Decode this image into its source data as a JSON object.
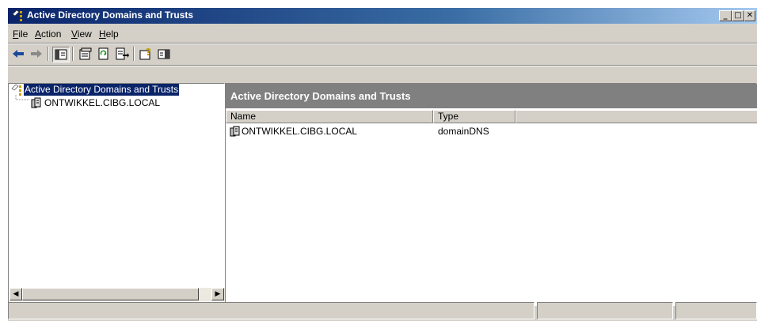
{
  "window": {
    "title": "Active Directory Domains and Trusts",
    "minimize": "_",
    "maximize": "□",
    "close": "✕"
  },
  "menu": {
    "items": [
      {
        "label": "File",
        "accel": "F",
        "rest": "ile"
      },
      {
        "label": "Action",
        "accel": "A",
        "rest": "ction"
      },
      {
        "label": "View",
        "accel": "V",
        "rest": "iew"
      },
      {
        "label": "Help",
        "accel": "H",
        "rest": "elp"
      }
    ]
  },
  "toolbar": {
    "back": "back-arrow-icon",
    "forward": "forward-arrow-icon",
    "show_hide_tree": "show-hide-console-tree-icon",
    "properties": "properties-icon",
    "refresh": "refresh-icon",
    "export_list": "export-list-icon",
    "help": "help-icon",
    "action_pane": "action-pane-icon"
  },
  "tree": {
    "root_label": "Active Directory Domains and Trusts",
    "child_label": "ONTWIKKEL.CIBG.LOCAL"
  },
  "details": {
    "header": "Active Directory Domains and Trusts",
    "columns": [
      "Name",
      "Type"
    ],
    "rows": [
      {
        "name": "ONTWIKKEL.CIBG.LOCAL",
        "type": "domainDNS"
      }
    ]
  },
  "colors": {
    "title_start": "#0a246a",
    "title_end": "#a6caf0",
    "selection": "#0a246a",
    "pane_header": "#808080",
    "chrome": "#d4d0c8"
  }
}
